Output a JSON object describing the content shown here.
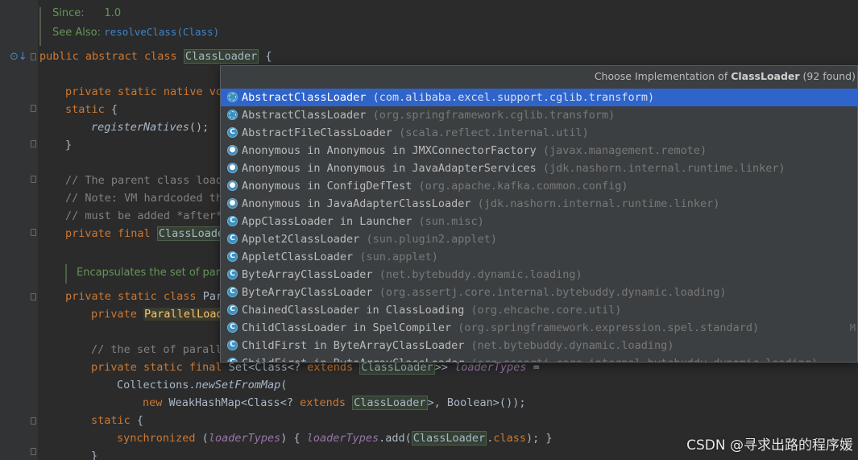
{
  "doc": {
    "since_label": "Since:",
    "since_value": "1.0",
    "see_also_label": "See Also:",
    "see_also_link": "resolveClass(Class)",
    "encapsulates": "Encapsulates the set of paral"
  },
  "code": {
    "class_decl": {
      "kw": "public abstract class",
      "name": "ClassLoader",
      "tail": " {"
    },
    "l1": {
      "kw": "private static native vo"
    },
    "l2": {
      "kw": "static",
      "tail": " {"
    },
    "l3": {
      "call": "registerNatives",
      "tail": "();"
    },
    "l4": "}",
    "c1": "// The parent class load",
    "c2": "// Note: VM hardcoded th",
    "c3": "// must be added *after*",
    "l5": {
      "kw": "private final",
      "name": "ClassLoade"
    },
    "l6": {
      "kw": "private static class",
      "rest": " Par"
    },
    "l7": {
      "kw": "private",
      "name": "ParallelLoad"
    },
    "c4": "// the set of parall",
    "l8": {
      "kw": "private static final",
      "rest": " Set<Class<? ",
      "kw2": "extends",
      "name": "ClassLoader",
      "tail": ">> ",
      "field": "loaderTypes",
      "eq": " ="
    },
    "l9": {
      "rest": "Collections.",
      "call": "newSetFromMap",
      "tail": "("
    },
    "l10": {
      "kw": "new",
      "rest": " WeakHashMap<Class<? ",
      "kw2": "extends",
      "name": "ClassLoader",
      "tail": ">, Boolean>());"
    },
    "l11": {
      "kw": "static",
      "tail": " {"
    },
    "l12": {
      "kw": "synchronized",
      "open": " (",
      "field": "loaderTypes",
      "mid": ") { ",
      "field2": "loaderTypes",
      "call": ".add(",
      "name": "ClassLoader",
      "dot": ".",
      "kw2": "class",
      "tail": "); }"
    },
    "l13": "}"
  },
  "popup": {
    "header_prefix": "Choose Implementation of ",
    "header_class": "ClassLoader",
    "header_suffix": " (92 found)",
    "items": [
      {
        "name": "AbstractClassLoader",
        "pkg": "(com.alibaba.excel.support.cglib.transform)",
        "icon": "abstract-class-icon"
      },
      {
        "name": "AbstractClassLoader",
        "pkg": "(org.springframework.cglib.transform)",
        "icon": "abstract-class-icon"
      },
      {
        "name": "AbstractFileClassLoader",
        "pkg": "(scala.reflect.internal.util)",
        "icon": "class-icon"
      },
      {
        "name": "Anonymous in Anonymous in JMXConnectorFactory",
        "pkg": "(javax.management.remote)",
        "icon": "anonymous-class-icon"
      },
      {
        "name": "Anonymous in Anonymous in JavaAdapterServices",
        "pkg": "(jdk.nashorn.internal.runtime.linker)",
        "icon": "anonymous-class-icon"
      },
      {
        "name": "Anonymous in ConfigDefTest",
        "pkg": "(org.apache.kafka.common.config)",
        "icon": "anonymous-class-icon"
      },
      {
        "name": "Anonymous in JavaAdapterClassLoader",
        "pkg": "(jdk.nashorn.internal.runtime.linker)",
        "icon": "anonymous-class-icon"
      },
      {
        "name": "AppClassLoader in Launcher",
        "pkg": "(sun.misc)",
        "icon": "class-icon"
      },
      {
        "name": "Applet2ClassLoader",
        "pkg": "(sun.plugin2.applet)",
        "icon": "class-icon"
      },
      {
        "name": "AppletClassLoader",
        "pkg": "(sun.applet)",
        "icon": "class-icon"
      },
      {
        "name": "ByteArrayClassLoader",
        "pkg": "(net.bytebuddy.dynamic.loading)",
        "icon": "class-icon"
      },
      {
        "name": "ByteArrayClassLoader",
        "pkg": "(org.assertj.core.internal.bytebuddy.dynamic.loading)",
        "icon": "class-icon"
      },
      {
        "name": "ChainedClassLoader in ClassLoading",
        "pkg": "(org.ehcache.core.util)",
        "icon": "class-icon"
      },
      {
        "name": "ChildClassLoader in SpelCompiler",
        "pkg": "(org.springframework.expression.spel.standard)",
        "icon": "class-icon",
        "trail": "M"
      },
      {
        "name": "ChildFirst in ByteArrayClassLoader",
        "pkg": "(net.bytebuddy.dynamic.loading)",
        "icon": "class-icon"
      },
      {
        "name": "ChildFirst in ByteArrayClassLoader",
        "pkg": "(org.assertj.core.internal.bytebuddy.dynamic.loading)",
        "icon": "class-icon"
      }
    ]
  },
  "watermark": "CSDN @寻求出路的程序媛",
  "colors": {
    "editor_bg": "#2b2b2b",
    "keyword": "#cc7832",
    "selection": "#2f65ca",
    "doc_text": "#629755"
  }
}
